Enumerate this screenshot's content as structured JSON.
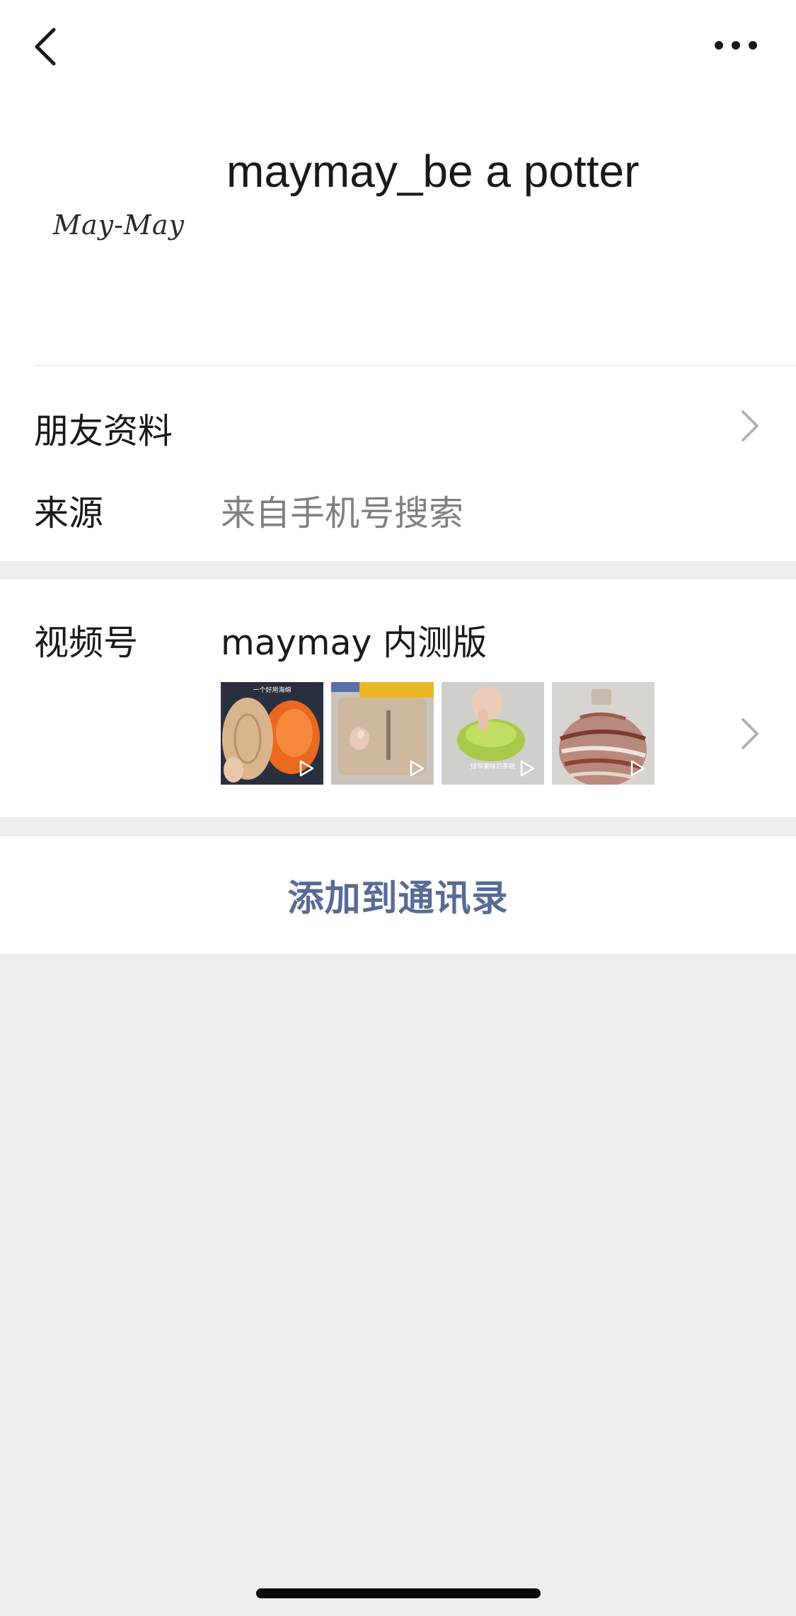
{
  "profile": {
    "name": "maymay_be a potter",
    "avatar_text": "May-May"
  },
  "friend_info": {
    "label": "朋友资料"
  },
  "source": {
    "label": "来源",
    "value": "来自手机号搜索"
  },
  "channels": {
    "label": "视频号",
    "name": "maymay 内测版",
    "thumbnails": [
      {
        "caption": "一个好用海绵"
      },
      {
        "caption": ""
      },
      {
        "caption": "绿苹果味的茶碗"
      },
      {
        "caption": ""
      }
    ]
  },
  "add_contact": {
    "label": "添加到通讯录"
  },
  "colors": {
    "link_blue": "#576b95",
    "secondary_text": "#808080",
    "background_gray": "#ededed"
  },
  "icons": {
    "back": "chevron-left-icon",
    "more": "more-dots-icon",
    "chevron": "chevron-right-icon",
    "play": "play-icon"
  }
}
